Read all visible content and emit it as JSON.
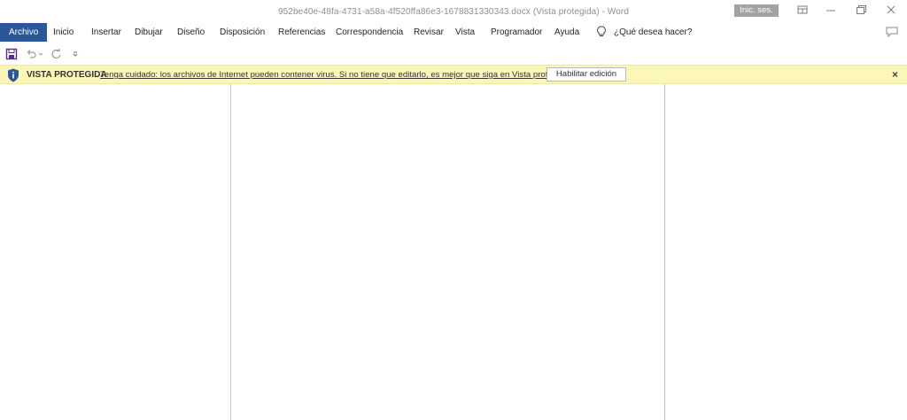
{
  "window": {
    "title": "952be40e-48fa-4731-a58a-4f520ffa86e3-1678831330343.docx (Vista protegida)  -  Word",
    "signin_label": "Inic. ses."
  },
  "ribbon": {
    "tabs": [
      {
        "label": "Archivo",
        "active": true
      },
      {
        "label": "Inicio"
      },
      {
        "label": "Insertar"
      },
      {
        "label": "Dibujar"
      },
      {
        "label": "Diseño"
      },
      {
        "label": "Disposición"
      },
      {
        "label": "Referencias"
      },
      {
        "label": "Correspondencia"
      },
      {
        "label": "Revisar"
      },
      {
        "label": "Vista"
      },
      {
        "label": "Programador"
      },
      {
        "label": "Ayuda"
      }
    ],
    "tell_me": "¿Qué desea hacer?"
  },
  "message_bar": {
    "title": "VISTA PROTEGIDA",
    "text": "Tenga cuidado: los archivos de Internet pueden contener virus. Si no tiene que editarlo, es mejor que siga en Vista protegida.",
    "button": "Habilitar edición",
    "close": "×"
  },
  "colors": {
    "accent": "#2b579a",
    "message_bar": "#fcf7b6",
    "shield": "#2b579a"
  }
}
